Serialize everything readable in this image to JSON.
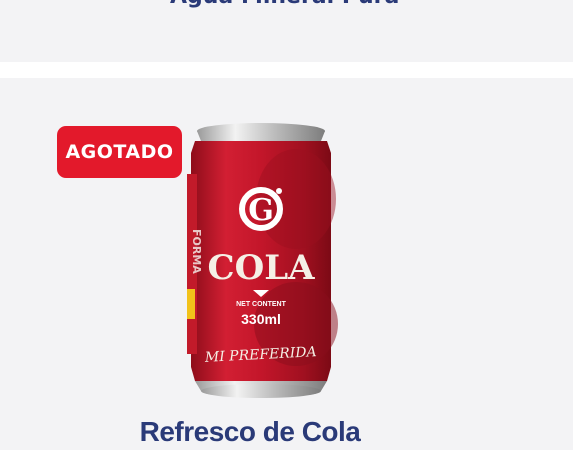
{
  "previous_card": {
    "partial_title": "Agua Mineral Pura"
  },
  "product": {
    "badge_label": "AGOTADO",
    "name": "Refresco de Cola",
    "image": {
      "brand_letter": "G",
      "brand_text": "COLA",
      "net_content_label": "NET CONTENT",
      "volume": "330ml",
      "slogan": "MI PREFERIDA"
    }
  },
  "colors": {
    "badge": "#e3192b",
    "title": "#2a3a78",
    "card_bg": "#f3f3f5",
    "can_red": "#c3162a"
  }
}
